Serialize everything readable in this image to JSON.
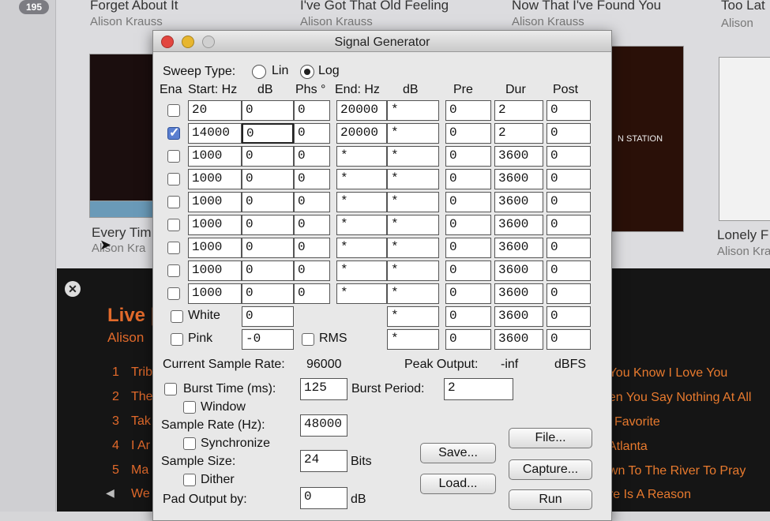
{
  "background": {
    "badge": "195",
    "top_songs": [
      {
        "title": "Forget About It",
        "artist": "Alison Krauss"
      },
      {
        "title": "I've Got That Old Feeling",
        "artist": "Alison Krauss"
      },
      {
        "title": "Now That I've Found You",
        "artist": "Alison Krauss"
      },
      {
        "title": "Too Lat",
        "artist": "Alison"
      }
    ],
    "album_titles": [
      {
        "title": "Every Tim",
        "artist": "Alison Kra"
      },
      {
        "title": "Lonely F",
        "artist": "Alison Kra"
      }
    ],
    "album_art_text": "N STATION",
    "live_title": "Live |",
    "live_artist": "Alison",
    "tracks": [
      {
        "num": "1",
        "name": "Trib"
      },
      {
        "num": "2",
        "name": "The"
      },
      {
        "num": "3",
        "name": "Tak"
      },
      {
        "num": "4",
        "name": "I Ar"
      },
      {
        "num": "5",
        "name": "Ma"
      },
      {
        "num": "",
        "name": "We"
      }
    ],
    "right_tracks": [
      "t You Know I Love You",
      "hen You Say Nothing At All",
      "w Favorite",
      ", Atlanta",
      "own To The River To Pray",
      "ere Is A Reason"
    ]
  },
  "window": {
    "title": "Signal Generator",
    "sweep_type_label": "Sweep Type:",
    "sweep_options": [
      "Lin",
      "Log"
    ],
    "sweep_selected": "Log",
    "headers": {
      "ena": "Ena",
      "start": "Start: Hz",
      "db1": "dB",
      "phs": "Phs °",
      "end": "End: Hz",
      "db2": "dB",
      "pre": "Pre",
      "dur": "Dur",
      "post": "Post"
    },
    "rows": [
      {
        "enabled": false,
        "start": "20",
        "db": "0",
        "phs": "0",
        "end": "20000",
        "edb": "*",
        "pre": "0",
        "dur": "2",
        "post": "0"
      },
      {
        "enabled": true,
        "start": "14000",
        "db": "0",
        "phs": "0",
        "end": "20000",
        "edb": "*",
        "pre": "0",
        "dur": "2",
        "post": "0"
      },
      {
        "enabled": false,
        "start": "1000",
        "db": "0",
        "phs": "0",
        "end": "*",
        "edb": "*",
        "pre": "0",
        "dur": "3600",
        "post": "0"
      },
      {
        "enabled": false,
        "start": "1000",
        "db": "0",
        "phs": "0",
        "end": "*",
        "edb": "*",
        "pre": "0",
        "dur": "3600",
        "post": "0"
      },
      {
        "enabled": false,
        "start": "1000",
        "db": "0",
        "phs": "0",
        "end": "*",
        "edb": "*",
        "pre": "0",
        "dur": "3600",
        "post": "0"
      },
      {
        "enabled": false,
        "start": "1000",
        "db": "0",
        "phs": "0",
        "end": "*",
        "edb": "*",
        "pre": "0",
        "dur": "3600",
        "post": "0"
      },
      {
        "enabled": false,
        "start": "1000",
        "db": "0",
        "phs": "0",
        "end": "*",
        "edb": "*",
        "pre": "0",
        "dur": "3600",
        "post": "0"
      },
      {
        "enabled": false,
        "start": "1000",
        "db": "0",
        "phs": "0",
        "end": "*",
        "edb": "*",
        "pre": "0",
        "dur": "3600",
        "post": "0"
      },
      {
        "enabled": false,
        "start": "1000",
        "db": "0",
        "phs": "0",
        "end": "*",
        "edb": "*",
        "pre": "0",
        "dur": "3600",
        "post": "0"
      }
    ],
    "white": {
      "label": "White",
      "db": "0",
      "edb": "*",
      "pre": "0",
      "dur": "3600",
      "post": "0"
    },
    "pink": {
      "label": "Pink",
      "db": "-0",
      "edb": "*",
      "pre": "0",
      "dur": "3600",
      "post": "0"
    },
    "rms_label": "RMS",
    "current_sample_rate_label": "Current Sample Rate:",
    "current_sample_rate": "96000",
    "peak_output_label": "Peak Output:",
    "peak_output": "-inf",
    "peak_unit": "dBFS",
    "burst_time_label": "Burst Time (ms):",
    "burst_time": "125",
    "burst_period_label": "Burst Period:",
    "burst_period": "2",
    "window_label": "Window",
    "sample_rate_label": "Sample Rate (Hz):",
    "sample_rate": "48000",
    "synchronize_label": "Synchronize",
    "sample_size_label": "Sample Size:",
    "sample_size": "24",
    "bits_label": "Bits",
    "dither_label": "Dither",
    "pad_output_label": "Pad Output by:",
    "pad_output": "0",
    "pad_unit": "dB",
    "buttons": {
      "save": "Save...",
      "load": "Load...",
      "file": "File...",
      "capture": "Capture...",
      "run": "Run"
    }
  }
}
